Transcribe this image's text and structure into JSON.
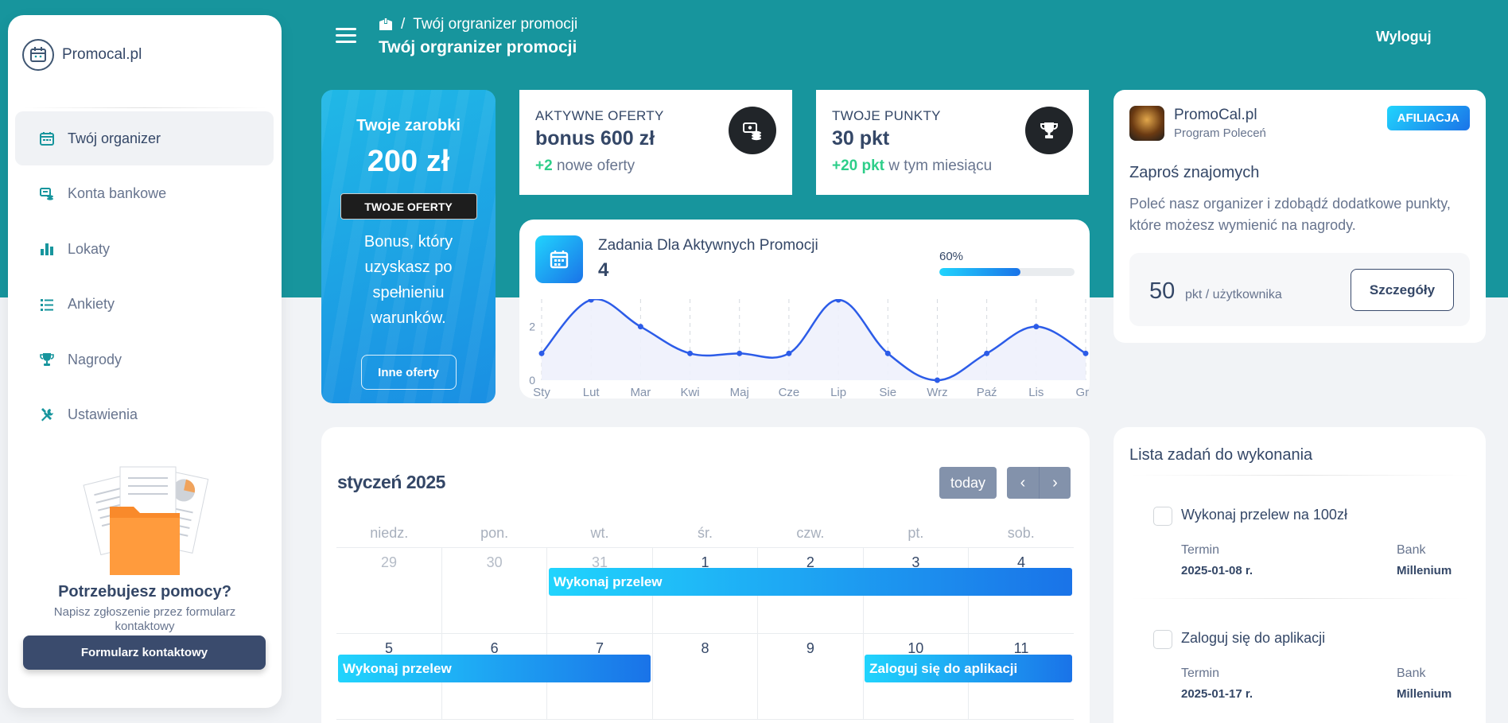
{
  "brand": {
    "name": "Promocal.pl"
  },
  "sidebar": {
    "items": [
      {
        "label": "Twój organizer",
        "icon": "calendar-icon",
        "active": true
      },
      {
        "label": "Konta bankowe",
        "icon": "bank-accounts-icon",
        "active": false
      },
      {
        "label": "Lokaty",
        "icon": "bar-chart-icon",
        "active": false
      },
      {
        "label": "Ankiety",
        "icon": "list-icon",
        "active": false
      },
      {
        "label": "Nagrody",
        "icon": "trophy-icon",
        "active": false
      },
      {
        "label": "Ustawienia",
        "icon": "tools-icon",
        "active": false
      }
    ],
    "help": {
      "title": "Potrzebujesz pomocy?",
      "subtitle": "Napisz zgłoszenie przez formularz kontaktowy",
      "button": "Formularz kontaktowy"
    }
  },
  "header": {
    "breadcrumb_home_icon": "home-box-icon",
    "breadcrumb_separator": "/",
    "breadcrumb": "Twój orgranizer promocji",
    "title": "Twój orgranizer promocji",
    "logout": "Wyloguj"
  },
  "earnings": {
    "title": "Twoje zarobki",
    "amount": "200 zł",
    "badge": "TWOJE OFERTY",
    "description": "Bonus, który uzyskasz po spełnieniu warunków.",
    "button": "Inne oferty"
  },
  "stats": {
    "offers": {
      "label": "AKTYWNE OFERTY",
      "value": "bonus 600 zł",
      "delta": "+2",
      "delta_text": "nowe oferty",
      "icon": "money-stack-icon"
    },
    "points": {
      "label": "TWOJE PUNKTY",
      "value": "30 pkt",
      "delta": "+20 pkt",
      "delta_text": "w tym miesiącu",
      "icon": "trophy-icon"
    }
  },
  "tasks": {
    "label": "Zadania Dla Aktywnych Promocji",
    "value": "4",
    "progress_label": "60%",
    "progress": 0.6
  },
  "chart_data": {
    "type": "line",
    "categories": [
      "Sty",
      "Lut",
      "Mar",
      "Kwi",
      "Maj",
      "Cze",
      "Lip",
      "Sie",
      "Wrz",
      "Paź",
      "Lis",
      "Gru"
    ],
    "series": [
      {
        "values": [
          1,
          3,
          2,
          1,
          1,
          1,
          3,
          1,
          0,
          1,
          2,
          1
        ]
      }
    ],
    "y_ticks": [
      "0",
      "2"
    ],
    "ylim": [
      0,
      3
    ],
    "grid": "vertical dashed",
    "colors": {
      "line": "#2c5ce8",
      "fill": "#eef1fc"
    }
  },
  "affiliate": {
    "name": "PromoCal.pl",
    "program": "Program Poleceń",
    "badge": "AFILIACJA",
    "heading": "Zaproś znajomych",
    "text": "Poleć nasz organizer i zdobądź dodatkowe punkty, które możesz wymienić na nagrody.",
    "points": "50",
    "unit": "pkt / użytkownika",
    "button": "Szczegóły"
  },
  "calendar": {
    "title": "styczeń 2025",
    "today": "today",
    "prev": "‹",
    "next": "›",
    "weekdays": [
      "niedz.",
      "pon.",
      "wt.",
      "śr.",
      "czw.",
      "pt.",
      "sob."
    ],
    "weeks": [
      [
        {
          "d": "29",
          "muted": true
        },
        {
          "d": "30",
          "muted": true
        },
        {
          "d": "31",
          "muted": true
        },
        {
          "d": "1"
        },
        {
          "d": "2"
        },
        {
          "d": "3"
        },
        {
          "d": "4"
        }
      ],
      [
        {
          "d": "5"
        },
        {
          "d": "6"
        },
        {
          "d": "7"
        },
        {
          "d": "8"
        },
        {
          "d": "9"
        },
        {
          "d": "10"
        },
        {
          "d": "11"
        }
      ]
    ],
    "events": [
      {
        "label": "Wykonaj przelew",
        "week": 0,
        "start": 2,
        "end": 6
      },
      {
        "label": "Wykonaj przelew",
        "week": 1,
        "start": 0,
        "end": 2
      },
      {
        "label": "Zaloguj się do aplikacji",
        "week": 1,
        "start": 5,
        "end": 6
      }
    ]
  },
  "todo": {
    "title": "Lista zadań do wykonania",
    "items": [
      {
        "title": "Wykonaj przelew na 100zł",
        "term_label": "Termin",
        "term": "2025-01-08 r.",
        "bank_label": "Bank",
        "bank": "Millenium"
      },
      {
        "title": "Zaloguj się do aplikacji",
        "term_label": "Termin",
        "term": "2025-01-17 r.",
        "bank_label": "Bank",
        "bank": "Millenium"
      }
    ]
  },
  "colors": {
    "teal": "#17959d",
    "accent": "#1a73e8",
    "success": "#2dce89",
    "dark": "#344767"
  }
}
